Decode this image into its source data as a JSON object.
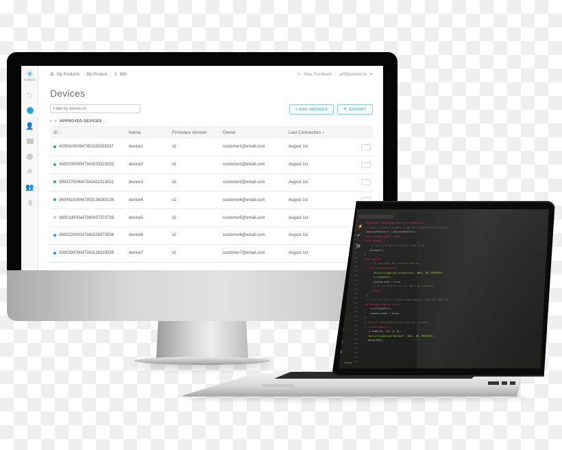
{
  "app": {
    "brand": "Particle"
  },
  "breadcrumb": {
    "items": [
      "My Products",
      "My Product",
      "999"
    ]
  },
  "topbar": {
    "feedback_label": "Give Feedback",
    "user_email": "jeff@particle.io"
  },
  "sidebar": {
    "items": [
      {
        "icon": "back-arrow-icon"
      },
      {
        "icon": "products-cube-icon",
        "active": true
      },
      {
        "icon": "user-icon"
      },
      {
        "icon": "console-icon"
      },
      {
        "icon": "download-icon"
      },
      {
        "icon": "network-icon"
      },
      {
        "icon": "team-icon"
      },
      {
        "icon": "sim-icon"
      }
    ]
  },
  "page": {
    "title": "Devices",
    "filter_placeholder": "Filter by device ID",
    "add_devices_label": "+ ADD DEVICES",
    "export_label": "EXPORT",
    "section_label": "APPROVED DEVICES"
  },
  "colors": {
    "accent": "#00aeef",
    "online": "#1fa3d6",
    "offline": "#c8c8c8",
    "approved_check": "#3bb54a"
  },
  "table": {
    "columns": [
      "ID",
      "Name",
      "Firmware Version",
      "Owner",
      "Last Connection"
    ],
    "rows": [
      {
        "id": "42003c000947353235303037",
        "name": "device1",
        "firmware": "v2",
        "owner": "customer1@email.com",
        "last_connection": "August 1st",
        "online": true
      },
      {
        "id": "3b0020000547343233323032",
        "name": "device2",
        "firmware": "v2",
        "owner": "customer2@email.com",
        "last_connection": "August 1st",
        "online": true
      },
      {
        "id": "390037000b47343432313031",
        "name": "device3",
        "firmware": "v2",
        "owner": "customer3@email.com",
        "last_connection": "August 1st",
        "online": true
      },
      {
        "id": "360041000447353138383138",
        "name": "device4",
        "firmware": "v2",
        "owner": "customer4@email.com",
        "last_connection": "August 1st",
        "online": true
      },
      {
        "id": "36002d000a47343337373738",
        "name": "device5",
        "firmware": "v2",
        "owner": "customer5@email.com",
        "last_connection": "August 1st",
        "online": false
      },
      {
        "id": "360022000247343339373536",
        "name": "device6",
        "firmware": "v2",
        "owner": "customer6@email.com",
        "last_connection": "August 1st",
        "online": true
      },
      {
        "id": "330039000b47343138333038",
        "name": "device7",
        "firmware": "v2",
        "owner": "customer7@email.com",
        "last_connection": "August 1st",
        "online": true
      }
    ],
    "row_action_label": "···"
  },
  "laptop_ide": {
    "code_lines": [
      "#include \"InternetButton/InternetButton.h\"",
      "",
      "/* Here's a basic example using the InternetButton library */",
      "InternetButton b = InternetButton();",
      "",
      "bool rainbow_mode = false;",
      "",
      "void setup() {",
      "    // Tell b to get everything ready to go",
      "    b.begin();",
      "}",
      "",
      "void loop(){",
      "    // If you shake the Internet Button...",
      "    if(b.allButtonsOn()){",
      "        Particle.publish(\"allbuttons\", NULL, 60, PRIVATE);",
      "        b.rainbow(5);",
      "        rainbow_mode = true;",
      "        // If all buttons are on, don't do anything",
      "        return;",
      "    }",
      "",
      "    // If we are not in rainbow mode anymore, turn the LEDs off",
      "    if(rainbow_mode == true){",
      "        b.allLedsOff();",
      "        rainbow_mode = false;",
      "    }",
      "",
      "    // Process individual buttons and LED response",
      "    if (b.buttonOn(1)) {",
      "        b.ledOn(11, 255, 0, 0);",
      "        Particle.publish(\"button1\", NULL, 60, PRIVATE);",
      "        delay(500);"
    ],
    "status_text": "Ready."
  }
}
